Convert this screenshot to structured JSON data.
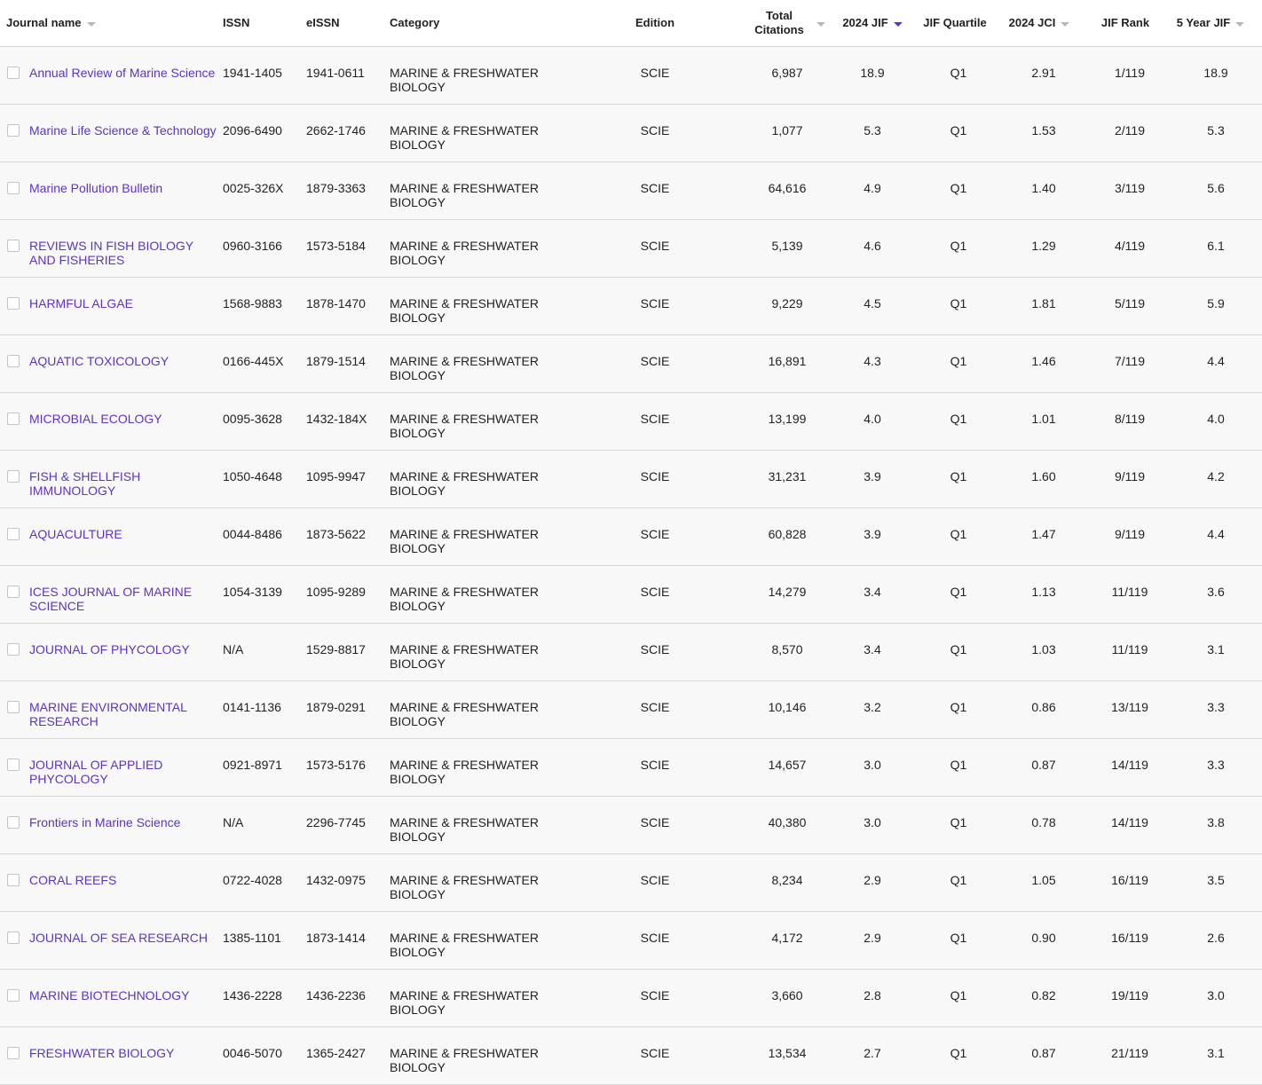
{
  "columns": {
    "journal_name": "Journal name",
    "issn": "ISSN",
    "eissn": "eISSN",
    "category": "Category",
    "edition": "Edition",
    "total_citations_line1": "Total",
    "total_citations_line2": "Citations",
    "jif": "2024 JIF",
    "jif_quartile": "JIF Quartile",
    "jci": "2024 JCI",
    "jif_rank": "JIF Rank",
    "five_year_jif": "5 Year JIF"
  },
  "colors": {
    "link": "#5e33bf",
    "active_sort": "#5e33bf",
    "inactive_sort": "#b8b8b8",
    "row_bg": "#f8f8f8",
    "divider": "#d9d9d9"
  },
  "rows": [
    {
      "name": "Annual Review of Marine Science",
      "issn": "1941-1405",
      "eissn": "1941-0611",
      "cat1": "MARINE & FRESHWATER",
      "cat2": "BIOLOGY",
      "edition": "SCIE",
      "citations": "6,987",
      "jif": "18.9",
      "quartile": "Q1",
      "jci": "2.91",
      "rank": "1/119",
      "jif5": "18.9"
    },
    {
      "name": "Marine Life Science & Technology",
      "issn": "2096-6490",
      "eissn": "2662-1746",
      "cat1": "MARINE & FRESHWATER",
      "cat2": "BIOLOGY",
      "edition": "SCIE",
      "citations": "1,077",
      "jif": "5.3",
      "quartile": "Q1",
      "jci": "1.53",
      "rank": "2/119",
      "jif5": "5.3"
    },
    {
      "name": "Marine Pollution Bulletin",
      "issn": "0025-326X",
      "eissn": "1879-3363",
      "cat1": "MARINE & FRESHWATER",
      "cat2": "BIOLOGY",
      "edition": "SCIE",
      "citations": "64,616",
      "jif": "4.9",
      "quartile": "Q1",
      "jci": "1.40",
      "rank": "3/119",
      "jif5": "5.6"
    },
    {
      "name": "REVIEWS IN FISH BIOLOGY AND FISHERIES",
      "issn": "0960-3166",
      "eissn": "1573-5184",
      "cat1": "MARINE & FRESHWATER",
      "cat2": "BIOLOGY",
      "edition": "SCIE",
      "citations": "5,139",
      "jif": "4.6",
      "quartile": "Q1",
      "jci": "1.29",
      "rank": "4/119",
      "jif5": "6.1"
    },
    {
      "name": "HARMFUL ALGAE",
      "issn": "1568-9883",
      "eissn": "1878-1470",
      "cat1": "MARINE & FRESHWATER",
      "cat2": "BIOLOGY",
      "edition": "SCIE",
      "citations": "9,229",
      "jif": "4.5",
      "quartile": "Q1",
      "jci": "1.81",
      "rank": "5/119",
      "jif5": "5.9"
    },
    {
      "name": "AQUATIC TOXICOLOGY",
      "issn": "0166-445X",
      "eissn": "1879-1514",
      "cat1": "MARINE & FRESHWATER",
      "cat2": "BIOLOGY",
      "edition": "SCIE",
      "citations": "16,891",
      "jif": "4.3",
      "quartile": "Q1",
      "jci": "1.46",
      "rank": "7/119",
      "jif5": "4.4"
    },
    {
      "name": "MICROBIAL ECOLOGY",
      "issn": "0095-3628",
      "eissn": "1432-184X",
      "cat1": "MARINE & FRESHWATER",
      "cat2": "BIOLOGY",
      "edition": "SCIE",
      "citations": "13,199",
      "jif": "4.0",
      "quartile": "Q1",
      "jci": "1.01",
      "rank": "8/119",
      "jif5": "4.0"
    },
    {
      "name": "FISH & SHELLFISH IMMUNOLOGY",
      "issn": "1050-4648",
      "eissn": "1095-9947",
      "cat1": "MARINE & FRESHWATER",
      "cat2": "BIOLOGY",
      "edition": "SCIE",
      "citations": "31,231",
      "jif": "3.9",
      "quartile": "Q1",
      "jci": "1.60",
      "rank": "9/119",
      "jif5": "4.2"
    },
    {
      "name": "AQUACULTURE",
      "issn": "0044-8486",
      "eissn": "1873-5622",
      "cat1": "MARINE & FRESHWATER",
      "cat2": "BIOLOGY",
      "edition": "SCIE",
      "citations": "60,828",
      "jif": "3.9",
      "quartile": "Q1",
      "jci": "1.47",
      "rank": "9/119",
      "jif5": "4.4"
    },
    {
      "name": "ICES JOURNAL OF MARINE SCIENCE",
      "issn": "1054-3139",
      "eissn": "1095-9289",
      "cat1": "MARINE & FRESHWATER",
      "cat2": "BIOLOGY",
      "edition": "SCIE",
      "citations": "14,279",
      "jif": "3.4",
      "quartile": "Q1",
      "jci": "1.13",
      "rank": "11/119",
      "jif5": "3.6"
    },
    {
      "name": "JOURNAL OF PHYCOLOGY",
      "issn": "N/A",
      "eissn": "1529-8817",
      "cat1": "MARINE & FRESHWATER",
      "cat2": "BIOLOGY",
      "edition": "SCIE",
      "citations": "8,570",
      "jif": "3.4",
      "quartile": "Q1",
      "jci": "1.03",
      "rank": "11/119",
      "jif5": "3.1"
    },
    {
      "name": "MARINE ENVIRONMENTAL RESEARCH",
      "issn": "0141-1136",
      "eissn": "1879-0291",
      "cat1": "MARINE & FRESHWATER",
      "cat2": "BIOLOGY",
      "edition": "SCIE",
      "citations": "10,146",
      "jif": "3.2",
      "quartile": "Q1",
      "jci": "0.86",
      "rank": "13/119",
      "jif5": "3.3"
    },
    {
      "name": "JOURNAL OF APPLIED PHYCOLOGY",
      "issn": "0921-8971",
      "eissn": "1573-5176",
      "cat1": "MARINE & FRESHWATER",
      "cat2": "BIOLOGY",
      "edition": "SCIE",
      "citations": "14,657",
      "jif": "3.0",
      "quartile": "Q1",
      "jci": "0.87",
      "rank": "14/119",
      "jif5": "3.3"
    },
    {
      "name": "Frontiers in Marine Science",
      "issn": "N/A",
      "eissn": "2296-7745",
      "cat1": "MARINE & FRESHWATER",
      "cat2": "BIOLOGY",
      "edition": "SCIE",
      "citations": "40,380",
      "jif": "3.0",
      "quartile": "Q1",
      "jci": "0.78",
      "rank": "14/119",
      "jif5": "3.8"
    },
    {
      "name": "CORAL REEFS",
      "issn": "0722-4028",
      "eissn": "1432-0975",
      "cat1": "MARINE & FRESHWATER",
      "cat2": "BIOLOGY",
      "edition": "SCIE",
      "citations": "8,234",
      "jif": "2.9",
      "quartile": "Q1",
      "jci": "1.05",
      "rank": "16/119",
      "jif5": "3.5"
    },
    {
      "name": "JOURNAL OF SEA RESEARCH",
      "issn": "1385-1101",
      "eissn": "1873-1414",
      "cat1": "MARINE & FRESHWATER",
      "cat2": "BIOLOGY",
      "edition": "SCIE",
      "citations": "4,172",
      "jif": "2.9",
      "quartile": "Q1",
      "jci": "0.90",
      "rank": "16/119",
      "jif5": "2.6"
    },
    {
      "name": "MARINE BIOTECHNOLOGY",
      "issn": "1436-2228",
      "eissn": "1436-2236",
      "cat1": "MARINE & FRESHWATER",
      "cat2": "BIOLOGY",
      "edition": "SCIE",
      "citations": "3,660",
      "jif": "2.8",
      "quartile": "Q1",
      "jci": "0.82",
      "rank": "19/119",
      "jif5": "3.0"
    },
    {
      "name": "FRESHWATER BIOLOGY",
      "issn": "0046-5070",
      "eissn": "1365-2427",
      "cat1": "MARINE & FRESHWATER",
      "cat2": "BIOLOGY",
      "edition": "SCIE",
      "citations": "13,534",
      "jif": "2.7",
      "quartile": "Q1",
      "jci": "0.87",
      "rank": "21/119",
      "jif5": "3.1"
    }
  ]
}
